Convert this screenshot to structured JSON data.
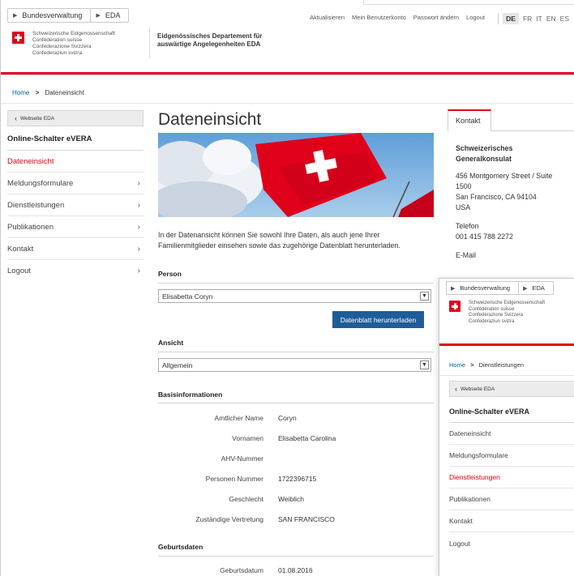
{
  "window_hint": "nebenmerkblatt",
  "topbar": {
    "crumbs": [
      "Bundesverwaltung",
      "EDA"
    ],
    "links": [
      "Aktualisieren",
      "Mein Benutzerkonto",
      "Passwort ändern",
      "Logout"
    ],
    "languages": [
      "DE",
      "FR",
      "IT",
      "EN",
      "ES"
    ],
    "active_language": "DE"
  },
  "brand": {
    "lang_lines": [
      "Schweizerische Eidgenossenschaft",
      "Confédération suisse",
      "Confederazione Svizzera",
      "Confederaziun svizra"
    ],
    "department_line1": "Eidgenössisches Departement für",
    "department_line2": "auswärtige Angelegenheiten EDA"
  },
  "breadcrumb": {
    "home": "Home",
    "sep": ">",
    "current": "Dateneinsicht"
  },
  "sidebar": {
    "back_label": "Webseite EDA",
    "title": "Online-Schalter eVERA",
    "items": [
      {
        "label": "Dateneinsicht",
        "chevron": ""
      },
      {
        "label": "Meldungsformulare",
        "chevron": "›"
      },
      {
        "label": "Dienstleistungen",
        "chevron": "›"
      },
      {
        "label": "Publikationen",
        "chevron": "›"
      },
      {
        "label": "Kontakt",
        "chevron": "›"
      },
      {
        "label": "Logout",
        "chevron": "›"
      }
    ]
  },
  "content": {
    "title": "Dateneinsicht",
    "intro": "In der Datenansicht können Sie sowohl Ihre Daten, als auch jene Ihrer Familienmitglieder einsehen sowie das zugehörige Datenblatt herunterladen.",
    "person_label": "Person",
    "person_value": "Elisabetta Coryn",
    "download_label": "Datenblatt herunterladen",
    "ansicht_label": "Ansicht",
    "ansicht_value": "Allgemein",
    "basis_label": "Basisinformationen",
    "basis": [
      {
        "k": "Amtlicher Name",
        "v": "Coryn"
      },
      {
        "k": "Vornamen",
        "v": "Elisabetta Carolina"
      },
      {
        "k": "AHV-Nummer",
        "v": ""
      },
      {
        "k": "Personen Nummer",
        "v": "1722396715"
      },
      {
        "k": "Geschlecht",
        "v": "Weiblich"
      },
      {
        "k": "Zuständige Vertretung",
        "v": "SAN FRANCISCO"
      }
    ],
    "geburt_label": "Geburtsdaten",
    "geburt": [
      {
        "k": "Geburtsdatum",
        "v": "01.08.2016"
      }
    ]
  },
  "contact": {
    "tab": "Kontakt",
    "org_line1": "Schweizerisches",
    "org_line2": "Generalkonsulat",
    "addr1": "456 Montgomery Street / Suite",
    "addr2": "1500",
    "addr3": "San Francisco, CA 94104",
    "addr4": "USA",
    "phone_label": "Telefon",
    "phone": "001 415 788 2272",
    "email_label": "E-Mail"
  },
  "overlay": {
    "crumbs": [
      "Bundesverwaltung",
      "EDA"
    ],
    "breadcrumb_home": "Home",
    "breadcrumb_current": "Dienstleistungen",
    "back_label": "Webseite EDA",
    "title": "Online-Schalter eVERA",
    "items": [
      {
        "label": "Dateneinsicht",
        "chevron": "›"
      },
      {
        "label": "Meldungsformulare",
        "chevron": "›"
      },
      {
        "label": "Dienstleistungen",
        "chevron": ""
      },
      {
        "label": "Publikationen",
        "chevron": "›"
      },
      {
        "label": "Kontakt",
        "chevron": "›"
      },
      {
        "label": "Logout",
        "chevron": "›"
      }
    ]
  },
  "colors": {
    "accent_red": "#e1001a",
    "button_blue": "#1f5c99",
    "link_blue": "#006699"
  }
}
